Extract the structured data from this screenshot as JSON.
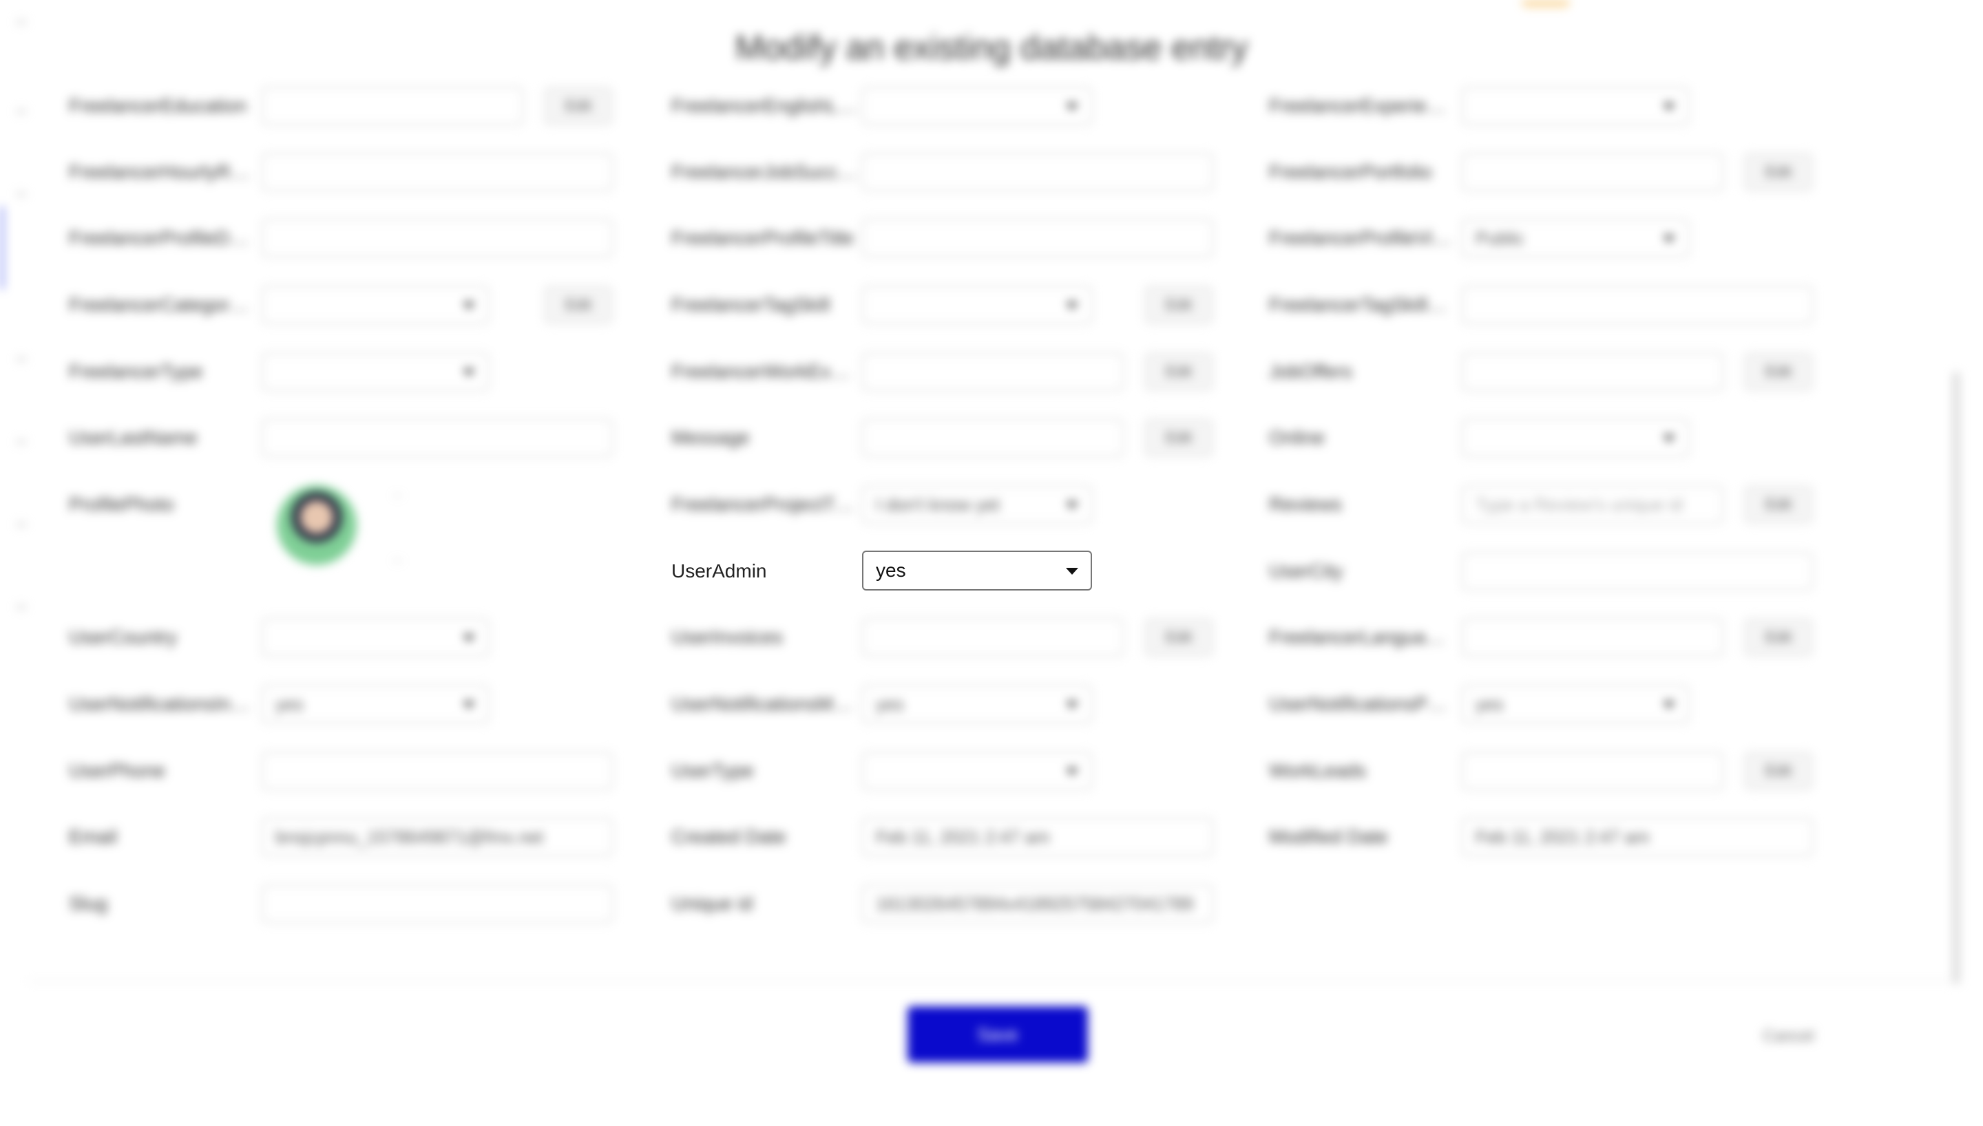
{
  "dialog": {
    "title": "Modify an existing database entry",
    "save_label": "Save",
    "cancel_label": "Cancel"
  },
  "fields": {
    "col1": [
      {
        "label": "FreelancerEducation",
        "value": "",
        "type": "text",
        "edit": "Edit"
      },
      {
        "label": "FreelancerHourlyRate",
        "value": "",
        "type": "text"
      },
      {
        "label": "FreelancerProfileDes…",
        "value": "",
        "type": "text"
      },
      {
        "label": "FreelancerCategory(T…",
        "value": "",
        "type": "select",
        "edit": "Edit"
      },
      {
        "label": "FreelancerType",
        "value": "",
        "type": "select"
      },
      {
        "label": "UserLastName",
        "value": "",
        "type": "text"
      },
      {
        "label": "ProfilePhoto",
        "value": "",
        "type": "photo",
        "photo_top": "...",
        "photo_bottom": "..."
      },
      {
        "label": "UserCountry",
        "value": "",
        "type": "select"
      },
      {
        "label": "UserNotificationsInv…",
        "value": "yes",
        "type": "select"
      },
      {
        "label": "UserPhone",
        "value": "",
        "type": "text"
      },
      {
        "label": "Email",
        "value": "bnsjcpnnu_1578649871@fmx.net",
        "type": "text"
      },
      {
        "label": "Slug",
        "value": "",
        "type": "text"
      }
    ],
    "col2": [
      {
        "label": "FreelancerEnglishLv…",
        "value": "",
        "type": "select"
      },
      {
        "label": "FreelancerJobSucces…",
        "value": "",
        "type": "text"
      },
      {
        "label": "FreelancerProfileTitle",
        "value": "",
        "type": "text"
      },
      {
        "label": "FreelancerTagSkill",
        "value": "",
        "type": "select",
        "edit": "Edit"
      },
      {
        "label": "FreelancerWorkExpe…",
        "value": "",
        "type": "text",
        "edit": "Edit"
      },
      {
        "label": "Message",
        "value": "",
        "type": "text",
        "edit": "Edit"
      },
      {
        "label": "FreelancerProjectTr…",
        "value": "I don't know yet",
        "type": "select"
      },
      {
        "label": "UserAdmin",
        "value": "yes",
        "type": "select",
        "sharp": true
      },
      {
        "label": "UserInvoices",
        "value": "",
        "type": "text",
        "edit": "Edit"
      },
      {
        "label": "UserNotificationsMe…",
        "value": "yes",
        "type": "select"
      },
      {
        "label": "UserType",
        "value": "",
        "type": "select"
      },
      {
        "label": "Created Date",
        "value": "Feb 11, 2021 2:47 am",
        "type": "text"
      },
      {
        "label": "Unique id",
        "value": "1613026457894x418925758427041789",
        "type": "text"
      }
    ],
    "col3": [
      {
        "label": "FreelancerExperienc…",
        "value": "",
        "type": "select"
      },
      {
        "label": "FreelancerPortfolio",
        "value": "",
        "type": "text",
        "edit": "Edit"
      },
      {
        "label": "FreelancerProfileVis…",
        "value": "Public",
        "type": "select"
      },
      {
        "label": "FreelancerTagSkillText",
        "value": "",
        "type": "text"
      },
      {
        "label": "JobOffers",
        "value": "",
        "type": "text",
        "edit": "Edit"
      },
      {
        "label": "Online",
        "value": "",
        "type": "select"
      },
      {
        "label": "Reviews",
        "value": "Type a Review's unique id",
        "type": "text",
        "edit": "Edit"
      },
      {
        "label": "UserCity",
        "value": "",
        "type": "text"
      },
      {
        "label": "FreelancerLanguages",
        "value": "",
        "type": "text",
        "edit": "Edit"
      },
      {
        "label": "UserNotificationsPay…",
        "value": "yes",
        "type": "select"
      },
      {
        "label": "WorkLeads",
        "value": "",
        "type": "text",
        "edit": "Edit"
      },
      {
        "label": "Modified Date",
        "value": "Feb 11, 2021 2:47 am",
        "type": "text"
      }
    ]
  },
  "useradmin": {
    "label": "UserAdmin",
    "value": "yes"
  }
}
